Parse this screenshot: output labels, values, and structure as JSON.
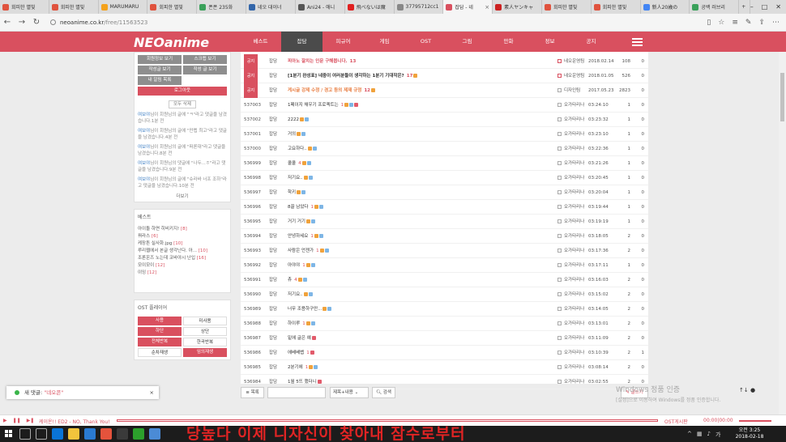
{
  "browser": {
    "tabs": [
      {
        "label": "회피한 별빛",
        "color": "#e0533e",
        "active": false
      },
      {
        "label": "회피한 별빛",
        "color": "#e0533e",
        "active": false
      },
      {
        "label": "MARUMARU",
        "color": "#f4a21c",
        "active": false
      },
      {
        "label": "회피한 별빛",
        "color": "#e0533e",
        "active": false
      },
      {
        "label": "폰폰 235화",
        "color": "#3aa15a",
        "active": false
      },
      {
        "label": "네오 대이너",
        "color": "#3366aa",
        "active": false
      },
      {
        "label": "Ani24 - 애니",
        "color": "#555555",
        "active": false
      },
      {
        "label": "飛べないは魔",
        "color": "#e02020",
        "active": false
      },
      {
        "label": "37795712cc1",
        "color": "#888888",
        "active": false
      },
      {
        "label": "잡담 - 네",
        "color": "#d9505f",
        "active": true
      },
      {
        "label": "素人ヤンキャ",
        "color": "#cc2222",
        "active": false
      },
      {
        "label": "회피한 별빛",
        "color": "#e0533e",
        "active": false
      },
      {
        "label": "회피한 별빛",
        "color": "#e0533e",
        "active": false
      },
      {
        "label": "新人20歳の",
        "color": "#4285f4",
        "active": false
      },
      {
        "label": "공백 러브리",
        "color": "#3aa15a",
        "active": false
      }
    ],
    "url_host": "neoanime.co.kr",
    "url_path": "/free/11563523"
  },
  "site": {
    "logo": "NEOanime",
    "nav": [
      "베스트",
      "잡담",
      "피규어",
      "게임",
      "OST",
      "그림",
      "만화",
      "정보",
      "공지"
    ],
    "active_nav": "잡담",
    "accent": "#d9505f"
  },
  "sidebar": {
    "member_buttons": [
      "회원정보 보기",
      "스크랩 보기",
      "작성글 보기",
      "작성 글 보기",
      "내 알림 목록",
      ""
    ],
    "logout": "로그아웃",
    "delete_all": "모두 삭제",
    "notifications": [
      {
        "who": "여보야",
        "text": "님이 회원님의 글에 \"ㅋ\"라고 댓글을 남겼습니다.1분 전"
      },
      {
        "who": "여보야",
        "text": "님이 회원님의 글에 \"만렙 최고\"라고 댓글을 남겼습니다.4분 전"
      },
      {
        "who": "여보야",
        "text": "님이 회원님의 글에 \"퍼론대\"라고 댓글을 남겼습니다.8분 전"
      },
      {
        "who": "여보야",
        "text": "님이 회원님의 댓글에 \"나두...ㅎ\"라고 댓글을 남겼습니다.9분 전"
      },
      {
        "who": "여보야",
        "text": "님이 회원님의 글에 \"슈라바 너프 조하\"라고 댓글을 남겼습니다.10분 전"
      }
    ],
    "more": "더보기",
    "best_title": "베스트",
    "best_items": [
      {
        "title": "아이돌 하면 히비키지!",
        "count": "[8]"
      },
      {
        "title": "꿔라스",
        "count": "[6]"
      },
      {
        "title": "케장튼 실사화.jpg",
        "count": "[10]"
      },
      {
        "title": "루리웹에서 본글 생각난다. 아...",
        "count": "[10]"
      },
      {
        "title": "조론온즈 노는데 코바야시 난입",
        "count": "[16]"
      },
      {
        "title": "모이모이",
        "count": "[12]"
      },
      {
        "title": "이잉",
        "count": "[12]"
      }
    ],
    "ost_title": "OST 플레이어",
    "ost_buttons": [
      {
        "label": "사용",
        "style": "red"
      },
      {
        "label": "미사용",
        "style": "light"
      },
      {
        "label": "하단",
        "style": "red"
      },
      {
        "label": "상단",
        "style": "light"
      },
      {
        "label": "전체반복",
        "style": "red"
      },
      {
        "label": "한곡반복",
        "style": "light"
      },
      {
        "label": "순차재생",
        "style": "light"
      },
      {
        "label": "임의재생",
        "style": "red"
      }
    ]
  },
  "posts": [
    {
      "num": "공지",
      "notice": true,
      "cat": "잡담",
      "title": "피아노 잘치는 인문 구해봅니다.",
      "tcolor": "red",
      "cmt": "13",
      "icons": "",
      "writer": "네오운영팀",
      "wred": true,
      "date": "2018.02.14",
      "hits": "108",
      "rec": "0"
    },
    {
      "num": "공지",
      "notice": true,
      "cat": "잡담",
      "title": "[1분기 완성표] 네중이 여러분들이 생각하는 1분기 기대작은?",
      "tcolor": "",
      "cmt": "17",
      "icons": "o",
      "writer": "네오운영팀",
      "wred": true,
      "date": "2018.01.05",
      "hits": "526",
      "rec": "0"
    },
    {
      "num": "공지",
      "notice": true,
      "cat": "잡담",
      "title": "게시글 강제 수정 / 경고 등의 제재 규정",
      "tcolor": "orange",
      "cmt": "12",
      "icons": "o",
      "writer": "디자인팀",
      "wred": false,
      "date": "2017.05.23",
      "hits": "2823",
      "rec": "0"
    },
    {
      "num": "537003",
      "notice": false,
      "cat": "잡담",
      "title": "1페이지 채우기 프로젝트는",
      "tcolor": "",
      "cmt": "1",
      "icons": "obr",
      "writer": "오가타리나",
      "wred": false,
      "date": "03:24:10",
      "hits": "1",
      "rec": "0"
    },
    {
      "num": "537002",
      "notice": false,
      "cat": "잡담",
      "title": "2222",
      "tcolor": "",
      "cmt": "",
      "icons": "ob",
      "writer": "오가타리나",
      "wred": false,
      "date": "03:23:32",
      "hits": "1",
      "rec": "0"
    },
    {
      "num": "537001",
      "notice": false,
      "cat": "잡담",
      "title": "거의",
      "tcolor": "",
      "cmt": "",
      "icons": "ob",
      "writer": "오가타리나",
      "wred": false,
      "date": "03:23:10",
      "hits": "1",
      "rec": "0"
    },
    {
      "num": "537000",
      "notice": false,
      "cat": "잡담",
      "title": "고요하다..",
      "tcolor": "",
      "cmt": "",
      "icons": "ob",
      "writer": "오가타리나",
      "wred": false,
      "date": "03:22:36",
      "hits": "1",
      "rec": "0"
    },
    {
      "num": "536999",
      "notice": false,
      "cat": "잡담",
      "title": "쿨쿨",
      "tcolor": "",
      "cmt": "4",
      "icons": "ob",
      "writer": "오가타리나",
      "wred": false,
      "date": "03:21:26",
      "hits": "1",
      "rec": "0"
    },
    {
      "num": "536998",
      "notice": false,
      "cat": "잡담",
      "title": "저기요..",
      "tcolor": "",
      "cmt": "",
      "icons": "ob",
      "writer": "오가타리나",
      "wred": false,
      "date": "03:20:45",
      "hits": "1",
      "rec": "0"
    },
    {
      "num": "536997",
      "notice": false,
      "cat": "잡담",
      "title": "학키",
      "tcolor": "",
      "cmt": "",
      "icons": "ob",
      "writer": "오가타리나",
      "wred": false,
      "date": "03:20:04",
      "hits": "1",
      "rec": "0"
    },
    {
      "num": "536996",
      "notice": false,
      "cat": "잡담",
      "title": "8끌 남았다",
      "tcolor": "",
      "cmt": "1",
      "icons": "ob",
      "writer": "오가타리나",
      "wred": false,
      "date": "03:19:44",
      "hits": "1",
      "rec": "0"
    },
    {
      "num": "536995",
      "notice": false,
      "cat": "잡담",
      "title": "거기 거기",
      "tcolor": "",
      "cmt": "",
      "icons": "ob",
      "writer": "오가타리나",
      "wred": false,
      "date": "03:19:19",
      "hits": "1",
      "rec": "0"
    },
    {
      "num": "536994",
      "notice": false,
      "cat": "잡담",
      "title": "안녕하세요",
      "tcolor": "",
      "cmt": "1",
      "icons": "ob",
      "writer": "오가타리나",
      "wred": false,
      "date": "03:18:05",
      "hits": "2",
      "rec": "0"
    },
    {
      "num": "536993",
      "notice": false,
      "cat": "잡담",
      "title": "사람은 언젠가",
      "tcolor": "",
      "cmt": "1",
      "icons": "ob",
      "writer": "오가타리나",
      "wred": false,
      "date": "03:17:36",
      "hits": "2",
      "rec": "0"
    },
    {
      "num": "536992",
      "notice": false,
      "cat": "잡담",
      "title": "아야야",
      "tcolor": "",
      "cmt": "1",
      "icons": "ob",
      "writer": "오가타리나",
      "wred": false,
      "date": "03:17:11",
      "hits": "1",
      "rec": "0"
    },
    {
      "num": "536991",
      "notice": false,
      "cat": "잡담",
      "title": "츄",
      "tcolor": "",
      "cmt": "4",
      "icons": "ob",
      "writer": "오가타리나",
      "wred": false,
      "date": "03:16:03",
      "hits": "2",
      "rec": "0"
    },
    {
      "num": "536990",
      "notice": false,
      "cat": "잡담",
      "title": "저기요..",
      "tcolor": "",
      "cmt": "",
      "icons": "ob",
      "writer": "오가타리나",
      "wred": false,
      "date": "03:15:02",
      "hits": "2",
      "rec": "0"
    },
    {
      "num": "536989",
      "notice": false,
      "cat": "잡담",
      "title": "너무 조용하구만...",
      "tcolor": "",
      "cmt": "",
      "icons": "ob",
      "writer": "오가타리나",
      "wred": false,
      "date": "03:14:05",
      "hits": "2",
      "rec": "0"
    },
    {
      "num": "536988",
      "notice": false,
      "cat": "잡담",
      "title": "하이루",
      "tcolor": "",
      "cmt": "1",
      "icons": "ob",
      "writer": "오가타리나",
      "wred": false,
      "date": "03:13:01",
      "hits": "2",
      "rec": "0"
    },
    {
      "num": "536987",
      "notice": false,
      "cat": "잡담",
      "title": "밑에 글은 예",
      "tcolor": "",
      "cmt": "",
      "icons": "r",
      "writer": "오가타리나",
      "wred": false,
      "date": "03:11:09",
      "hits": "2",
      "rec": "0"
    },
    {
      "num": "536986",
      "notice": false,
      "cat": "잡담",
      "title": "에베베벱",
      "tcolor": "",
      "cmt": "1",
      "icons": "r",
      "writer": "오가타리나",
      "wred": false,
      "date": "03:10:39",
      "hits": "2",
      "rec": "1"
    },
    {
      "num": "536985",
      "notice": false,
      "cat": "잡담",
      "title": "2분기에",
      "tcolor": "",
      "cmt": "1",
      "icons": "ob",
      "writer": "오가타리나",
      "wred": false,
      "date": "03:08:14",
      "hits": "2",
      "rec": "0"
    },
    {
      "num": "536984",
      "notice": false,
      "cat": "잡담",
      "title": "1월 5뜨 했더니",
      "tcolor": "",
      "cmt": "",
      "icons": "r",
      "writer": "오가타리나",
      "wred": false,
      "date": "03:02:55",
      "hits": "2",
      "rec": "0"
    }
  ],
  "search": {
    "list_button": "목록",
    "select_value": "제목+내용",
    "search_button": "검색",
    "write_button": "글쓰기"
  },
  "toast": {
    "prefix": "새 댓글: ",
    "quote": "\"네오콘\"",
    "close": "×"
  },
  "watermark": {
    "line1": "Windows 정품 인증",
    "line2": "[설정]으로 이동하여 Windows를 정품 인증합니다."
  },
  "player": {
    "title": "케이온!! ED2 - NO, Thank You!",
    "tag": "OST게시판",
    "time": "00:00|00:00",
    "progress": 0
  },
  "taskbar": {
    "overlay": "당높다 이제 니자신이 찾아내 잠수로부터",
    "time": "오전 3:25",
    "date": "2018-02-18"
  }
}
